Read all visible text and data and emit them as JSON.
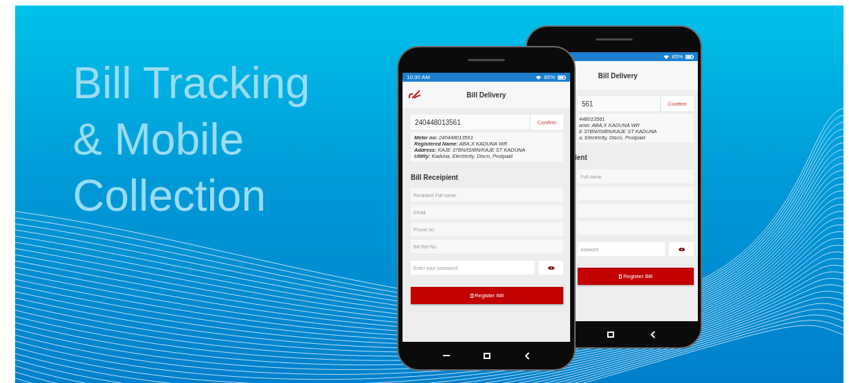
{
  "headline_lines": [
    "Bill Tracking",
    "& Mobile",
    "Collection"
  ],
  "front_phone": {
    "status_time": "10:30 AM",
    "status_battery": "85%",
    "title": "Bill Delivery",
    "meter_input": "240448013561",
    "confirm": "Confirm",
    "details": [
      "**Meter no:** 240448013561",
      "**Registered Name:** ABA,X KADUNA WR",
      "**Address:** KAJE 37BN/ISIBN/KAJE ST KADUNA",
      "**Utility:** Kaduna, Electricity, Disco, Postpaid"
    ],
    "section_heading": "Bill Receipient",
    "fields": [
      {
        "kind": "text",
        "placeholder": "Recipient Full name"
      },
      {
        "kind": "text",
        "placeholder": "Email"
      },
      {
        "kind": "text",
        "placeholder": "Phone no"
      },
      {
        "kind": "text",
        "placeholder": "Bill Ref No"
      },
      {
        "kind": "password",
        "placeholder": "Enter your password"
      }
    ],
    "button": "Register Bill"
  },
  "back_phone": {
    "status_battery": "85%",
    "title": "Bill Delivery",
    "meter_input": "561",
    "confirm": "Confirm",
    "details": [
      "448013561",
      "ame: ABA,X KADUNA WR",
      "E 37BN/ISIBN/KAJE ST KADUNA",
      "a, Electricity, Disco, Postpaid"
    ],
    "section_heading": "ient",
    "fields": [
      {
        "kind": "text",
        "placeholder": "Full name"
      },
      {
        "kind": "blank"
      },
      {
        "kind": "blank"
      },
      {
        "kind": "blank"
      },
      {
        "kind": "password",
        "placeholder": "assword"
      }
    ],
    "button": "Register Bill"
  }
}
